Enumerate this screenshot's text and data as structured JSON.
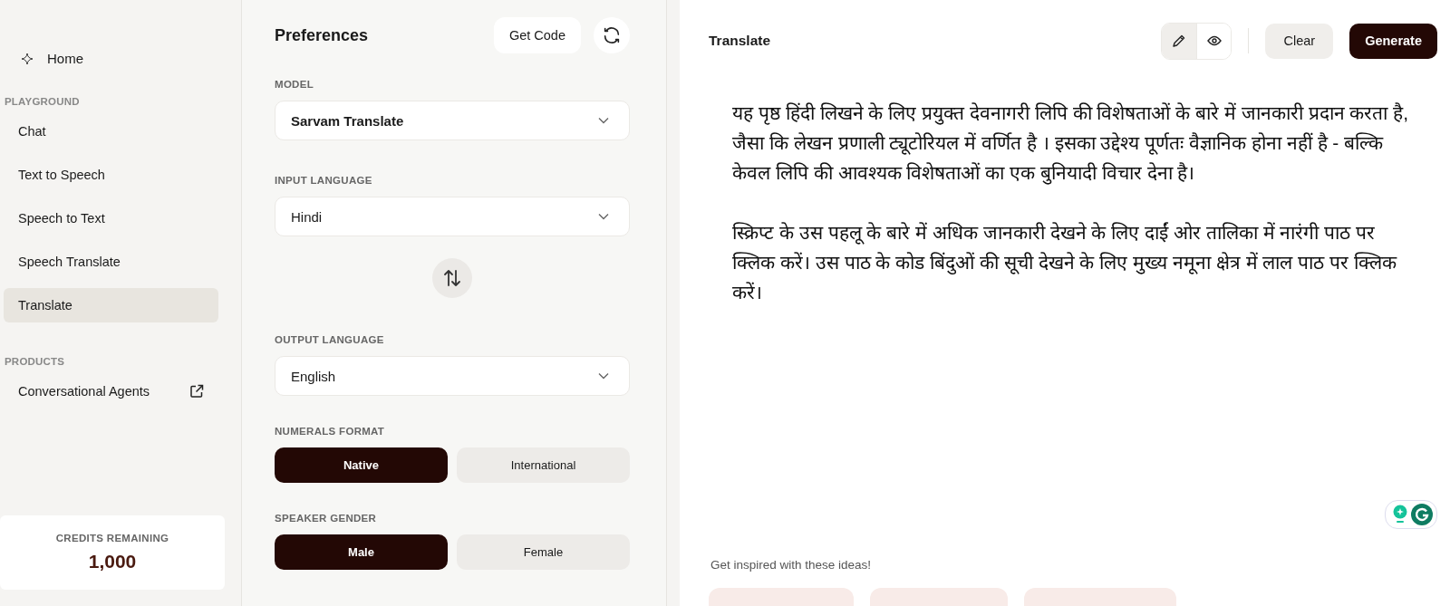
{
  "sidebar": {
    "home": {
      "label": "Home"
    },
    "sections": [
      {
        "title": "PLAYGROUND",
        "items": [
          {
            "label": "Chat",
            "selected": false,
            "external": false
          },
          {
            "label": "Text to Speech",
            "selected": false,
            "external": false
          },
          {
            "label": "Speech to Text",
            "selected": false,
            "external": false
          },
          {
            "label": "Speech Translate",
            "selected": false,
            "external": false
          },
          {
            "label": "Translate",
            "selected": true,
            "external": false
          }
        ]
      },
      {
        "title": "PRODUCTS",
        "items": [
          {
            "label": "Conversational Agents",
            "selected": false,
            "external": true
          }
        ]
      }
    ],
    "credits": {
      "label": "CREDITS REMAINING",
      "value": "1,000"
    }
  },
  "preferences": {
    "title": "Preferences",
    "get_code": "Get Code",
    "fields": [
      {
        "kind": "select",
        "label": "MODEL",
        "value": "Sarvam Translate",
        "emphasized": true
      },
      {
        "kind": "select",
        "label": "INPUT LANGUAGE",
        "value": "Hindi",
        "emphasized": false
      },
      {
        "kind": "swap"
      },
      {
        "kind": "select",
        "label": "OUTPUT LANGUAGE",
        "value": "English",
        "emphasized": false
      },
      {
        "kind": "toggle",
        "label": "NUMERALS FORMAT",
        "options": [
          {
            "label": "Native",
            "selected": true
          },
          {
            "label": "International",
            "selected": false
          }
        ]
      },
      {
        "kind": "toggle",
        "label": "SPEAKER GENDER",
        "options": [
          {
            "label": "Male",
            "selected": true
          },
          {
            "label": "Female",
            "selected": false
          }
        ]
      }
    ]
  },
  "main": {
    "title": "Translate",
    "modes": [
      {
        "kind": "edit",
        "selected": true
      },
      {
        "kind": "preview",
        "selected": false
      }
    ],
    "clear": "Clear",
    "generate": "Generate",
    "paragraphs": [
      "यह पृष्ठ हिंदी लिखने के लिए प्रयुक्त देवनागरी लिपि की विशेषताओं के बारे में जानकारी प्रदान करता है, जैसा कि लेखन प्रणाली ट्यूटोरियल में वर्णित है । इसका उद्देश्य पूर्णतः वैज्ञानिक होना नहीं है - बल्कि केवल लिपि की आवश्यक विशेषताओं का एक बुनियादी विचार देना है।",
      "स्क्रिप्ट के उस पहलू के बारे में अधिक जानकारी देखने के लिए दाईं ओर तालिका में नारंगी पाठ पर क्लिक करें। उस पाठ के कोड बिंदुओं की सूची देखने के लिए मुख्य नमूना क्षेत्र में लाल पाठ पर क्लिक करें।"
    ],
    "ideas_heading": "Get inspired with these ideas!"
  }
}
